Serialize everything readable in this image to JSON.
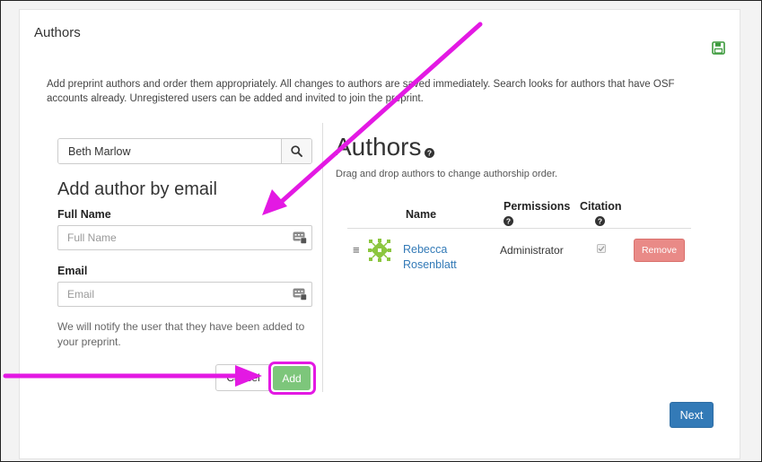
{
  "section": {
    "title": "Authors",
    "intro": "Add preprint authors and order them appropriately. All changes to authors are saved immediately. Search looks for authors that have OSF accounts already. Unregistered users can be added and invited to join the preprint."
  },
  "search": {
    "value": "Beth Marlow"
  },
  "add_by_email": {
    "heading": "Add author by email",
    "full_name_label": "Full Name",
    "full_name_placeholder": "Full Name",
    "email_label": "Email",
    "email_placeholder": "Email",
    "notify_text": "We will notify the user that they have been added to your preprint.",
    "cancel_label": "Cancel",
    "add_label": "Add"
  },
  "authors_panel": {
    "heading": "Authors",
    "drag_hint": "Drag and drop authors to change authorship order.",
    "columns": {
      "name": "Name",
      "permissions": "Permissions",
      "citation": "Citation"
    },
    "rows": [
      {
        "name": "Rebecca Rosenblatt",
        "permission": "Administrator",
        "citation_checked": true,
        "remove_label": "Remove"
      }
    ]
  },
  "footer": {
    "next_label": "Next"
  },
  "colors": {
    "add_button": "#7dc67b",
    "remove_button": "#e98a87",
    "next_button": "#337ab7",
    "link": "#337ab7",
    "annotation": "#e319e3",
    "save_icon": "#3c9a3c"
  },
  "icons": [
    "save-icon",
    "search-icon",
    "keyboard-icon",
    "help-icon",
    "drag-handle-icon",
    "avatar-identicon",
    "check-icon"
  ]
}
